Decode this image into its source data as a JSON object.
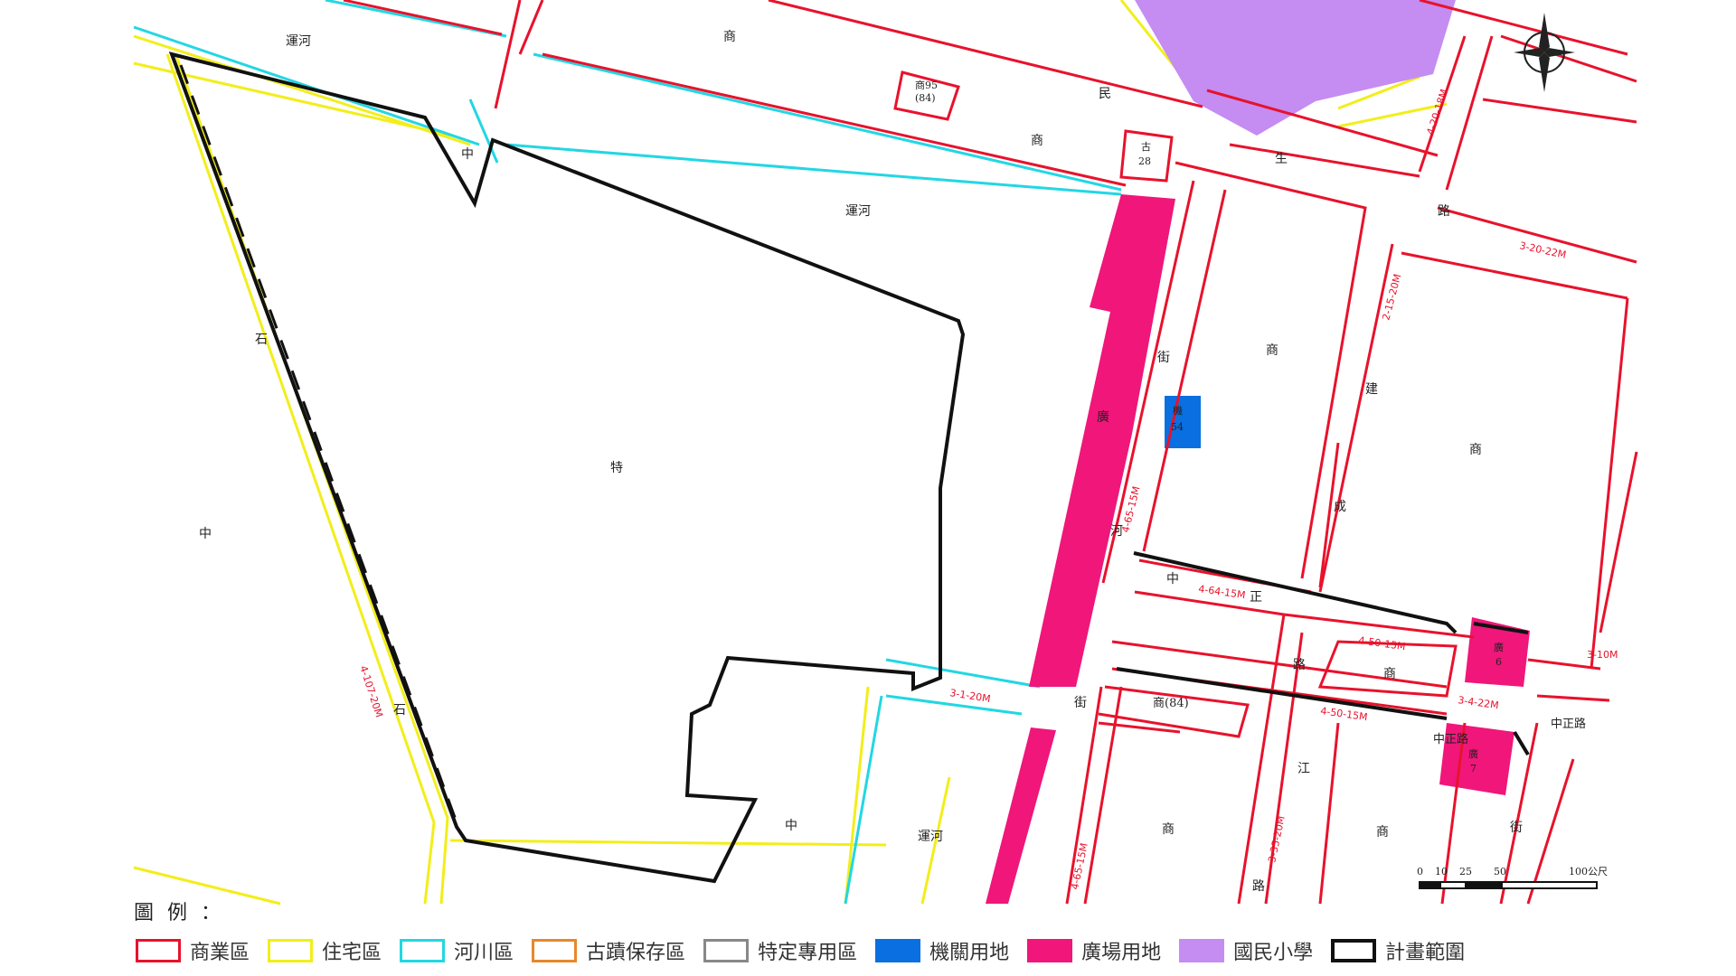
{
  "labels": {
    "canal": "運河",
    "shang": "商",
    "min": "民",
    "sheng": "生",
    "road": "路",
    "street": "街",
    "jian": "建",
    "cheng": "成",
    "zhong": "中",
    "te": "特",
    "he": "河",
    "guang": "廣",
    "zheng": "正",
    "jiang": "江",
    "shi": "石",
    "gu28": "古\n28",
    "ji54": "機\n54",
    "guang_plaza_a": "廣\n6",
    "guang_plaza_b": "廣\n7",
    "shang_95": "商95\n(84)",
    "shang_84": "商(84)",
    "zhongzheng_road": "中正路",
    "zhongzheng_road_b": "中正路"
  },
  "road_codes": {
    "r1": "4-20-18M",
    "r2": "3-20-22M",
    "r3": "2-15-20M",
    "r4": "4-65-15M",
    "r5": "4-65-15M",
    "r6": "4-64-15M",
    "r7": "4-50-15M",
    "r8": "4-50-15M",
    "r9": "3-1-20M",
    "r10": "3-4-22M",
    "r11": "3-35-20M",
    "r12": "4-107-20M",
    "r13": "3-10M"
  },
  "scale_bar": {
    "ticks": [
      "0",
      "10",
      "25",
      "50"
    ],
    "max_label": "100公尺"
  },
  "legend": {
    "title": "圖 例 ：",
    "items": [
      {
        "label": "商業區",
        "fill": "#ffffff",
        "stroke": "#e8122c",
        "icon": "commercial-zone-swatch"
      },
      {
        "label": "住宅區",
        "fill": "#ffffff",
        "stroke": "#f2ee1a",
        "icon": "residential-zone-swatch"
      },
      {
        "label": "河川區",
        "fill": "#ffffff",
        "stroke": "#22d7e3",
        "icon": "river-zone-swatch"
      },
      {
        "label": "古蹟保存區",
        "fill": "#ffffff",
        "stroke": "#e8872c",
        "icon": "heritage-zone-swatch"
      },
      {
        "label": "特定專用區",
        "fill": "#ffffff",
        "stroke": "#888888",
        "icon": "special-zone-swatch"
      },
      {
        "label": "機關用地",
        "fill": "#0a6fe0",
        "stroke": "#0a6fe0",
        "icon": "government-land-swatch"
      },
      {
        "label": "廣場用地",
        "fill": "#f0167a",
        "stroke": "#f0167a",
        "icon": "plaza-land-swatch"
      },
      {
        "label": "國民小學",
        "fill": "#c58cf2",
        "stroke": "#c58cf2",
        "icon": "elementary-school-swatch"
      },
      {
        "label": "計畫範圍",
        "fill": "#ffffff",
        "stroke": "#111111",
        "icon": "plan-boundary-swatch"
      }
    ]
  },
  "colors": {
    "commercial": "#e8122c",
    "residential": "#f2ee1a",
    "river": "#22d7e3",
    "plaza": "#f0167a",
    "government": "#0a6fe0",
    "school": "#c58cf2",
    "boundary": "#111111"
  }
}
